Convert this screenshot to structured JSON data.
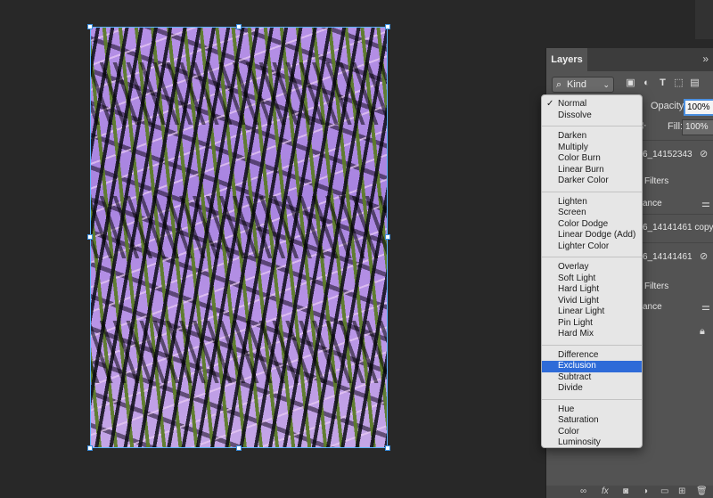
{
  "layers_panel": {
    "tab_label": "Layers",
    "collapse_symbol": "»",
    "kind_label": "Kind",
    "opacity_label": "Opacity:",
    "opacity_value": "100%",
    "fill_label": "Fill:",
    "fill_value": "100%",
    "layers": [
      {
        "name": "6_14152343"
      },
      {
        "name": "6_14141461 copy"
      },
      {
        "name": "6_14141461"
      }
    ],
    "smart_filters_label": "Filters",
    "adjustment_label": "ance"
  },
  "blend_menu": {
    "groups": [
      [
        {
          "label": "Normal",
          "checked": true
        },
        {
          "label": "Dissolve"
        }
      ],
      [
        {
          "label": "Darken"
        },
        {
          "label": "Multiply"
        },
        {
          "label": "Color Burn"
        },
        {
          "label": "Linear Burn"
        },
        {
          "label": "Darker Color"
        }
      ],
      [
        {
          "label": "Lighten"
        },
        {
          "label": "Screen"
        },
        {
          "label": "Color Dodge"
        },
        {
          "label": "Linear Dodge (Add)"
        },
        {
          "label": "Lighter Color"
        }
      ],
      [
        {
          "label": "Overlay"
        },
        {
          "label": "Soft Light"
        },
        {
          "label": "Hard Light"
        },
        {
          "label": "Vivid Light"
        },
        {
          "label": "Linear Light"
        },
        {
          "label": "Pin Light"
        },
        {
          "label": "Hard Mix"
        }
      ],
      [
        {
          "label": "Difference"
        },
        {
          "label": "Exclusion",
          "selected": true
        },
        {
          "label": "Subtract"
        },
        {
          "label": "Divide"
        }
      ],
      [
        {
          "label": "Hue"
        },
        {
          "label": "Saturation"
        },
        {
          "label": "Color"
        },
        {
          "label": "Luminosity"
        }
      ]
    ]
  },
  "colors": {
    "app_background": "#282828",
    "panel_background": "#535353",
    "menu_background": "#e6e6e6",
    "selection_highlight": "#2e6bd8",
    "artwork_purple": "#b08ce6",
    "artwork_green": "#5c7c28"
  },
  "icons": {
    "filter_icons": [
      "image-filter-icon",
      "adjustment-filter-icon",
      "type-filter-icon",
      "shape-filter-icon",
      "smart-object-filter-icon"
    ]
  }
}
